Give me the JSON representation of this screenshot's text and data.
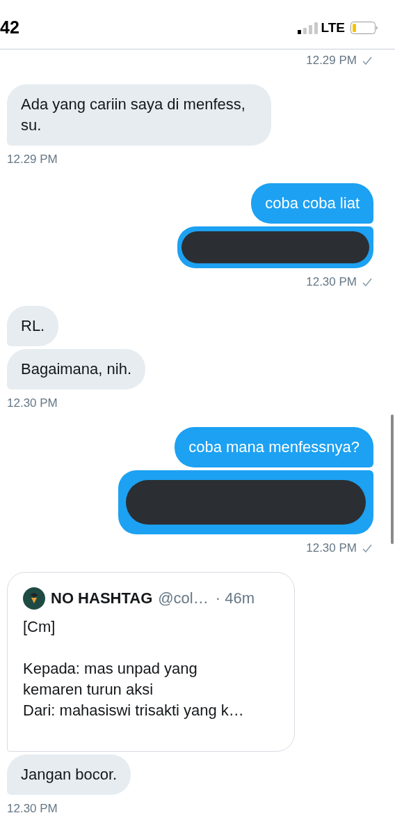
{
  "status_bar": {
    "time": "42",
    "network": "LTE"
  },
  "messages": [
    {
      "kind": "time",
      "outgoing": true,
      "text": "12.29 PM",
      "read": true
    },
    {
      "kind": "bubble",
      "outgoing": false,
      "text": "Ada yang cariin saya di menfess, su."
    },
    {
      "kind": "time",
      "outgoing": false,
      "text": "12.29 PM",
      "read": false
    },
    {
      "kind": "bubble",
      "outgoing": true,
      "text": "coba coba liat"
    },
    {
      "kind": "redacted",
      "outgoing": true
    },
    {
      "kind": "time",
      "outgoing": true,
      "text": "12.30 PM",
      "read": true
    },
    {
      "kind": "bubble",
      "outgoing": false,
      "text": "RL."
    },
    {
      "kind": "bubble",
      "outgoing": false,
      "text": "Bagaimana, nih."
    },
    {
      "kind": "time",
      "outgoing": false,
      "text": "12.30 PM",
      "read": false
    },
    {
      "kind": "bubble",
      "outgoing": true,
      "text": "coba mana menfessnya?"
    },
    {
      "kind": "redacted",
      "outgoing": true
    },
    {
      "kind": "time",
      "outgoing": true,
      "text": "12.30 PM",
      "read": true
    },
    {
      "kind": "quote",
      "outgoing": false,
      "name": "NO HASHTAG",
      "handle": "@col…",
      "age": "· 46m",
      "lines": [
        "[Cm]",
        "Kepada: mas unpad yang kemaren turun aksi",
        "Dari: mahasiswi trisakti yang k…"
      ]
    },
    {
      "kind": "bubble",
      "outgoing": false,
      "text": "Jangan bocor."
    },
    {
      "kind": "time",
      "outgoing": false,
      "text": "12.30 PM",
      "read": false
    }
  ]
}
